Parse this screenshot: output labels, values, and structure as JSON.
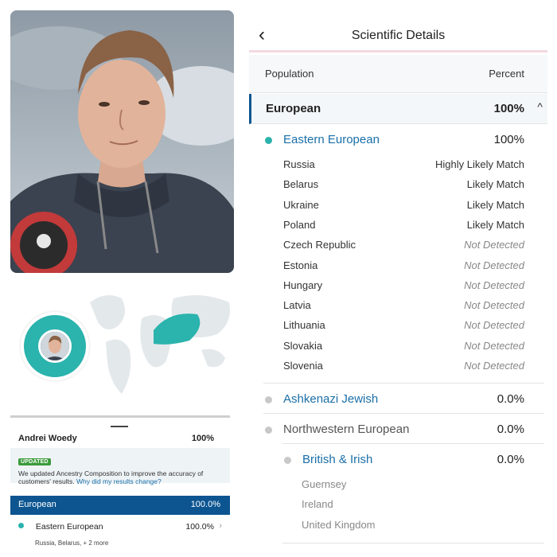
{
  "left": {
    "card": {
      "name": "Andrei Woedy",
      "percent": "100%",
      "badge": "UPDATED",
      "update_message": "We updated Ancestry Composition to improve the accuracy of customers' results.",
      "update_link": "Why did my results change?",
      "population": "European",
      "population_percent": "100.0%",
      "region": "Eastern European",
      "region_percent": "100.0%",
      "region_chevron": "›",
      "region_countries": "Russia, Belarus, + 2 more"
    }
  },
  "right": {
    "header": {
      "back_icon": "‹",
      "title": "Scientific Details"
    },
    "columns": {
      "population": "Population",
      "percent": "Percent"
    },
    "top_population": {
      "name": "European",
      "percent": "100%",
      "chevron": "^"
    },
    "eastern_european": {
      "name": "Eastern European",
      "percent": "100%",
      "countries": [
        {
          "name": "Russia",
          "match": "Highly Likely Match"
        },
        {
          "name": "Belarus",
          "match": "Likely Match"
        },
        {
          "name": "Ukraine",
          "match": "Likely Match"
        },
        {
          "name": "Poland",
          "match": "Likely Match"
        },
        {
          "name": "Czech Republic",
          "match": "Not Detected"
        },
        {
          "name": "Estonia",
          "match": "Not Detected"
        },
        {
          "name": "Hungary",
          "match": "Not Detected"
        },
        {
          "name": "Latvia",
          "match": "Not Detected"
        },
        {
          "name": "Lithuania",
          "match": "Not Detected"
        },
        {
          "name": "Slovakia",
          "match": "Not Detected"
        },
        {
          "name": "Slovenia",
          "match": "Not Detected"
        }
      ]
    },
    "ashkenazi": {
      "name": "Ashkenazi Jewish",
      "percent": "0.0%"
    },
    "northwestern": {
      "name": "Northwestern European",
      "percent": "0.0%"
    },
    "british_irish": {
      "name": "British & Irish",
      "percent": "0.0%",
      "countries": [
        "Guernsey",
        "Ireland",
        "United Kingdom"
      ]
    }
  },
  "colors": {
    "teal": "#2bb3ad",
    "navy": "#0c5591",
    "link": "#1a6fa8",
    "badge_green": "#3c9b3c"
  }
}
